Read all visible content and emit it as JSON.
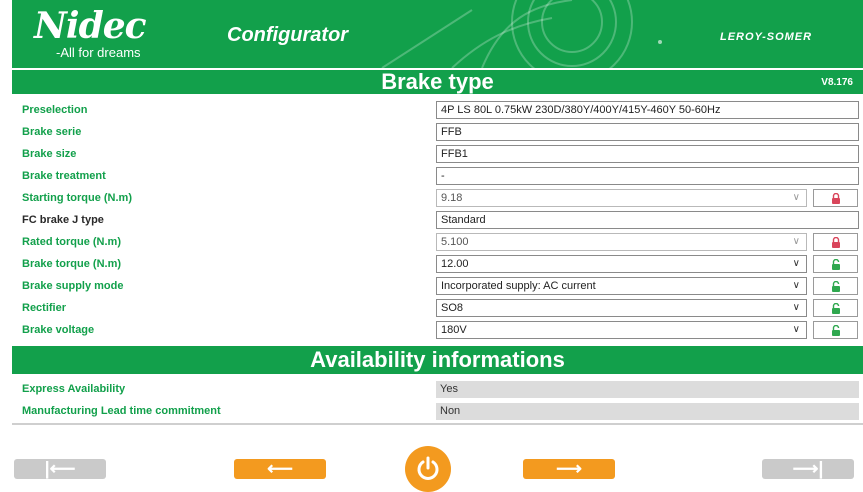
{
  "header": {
    "logo": "Nidec",
    "tagline": "-All for dreams",
    "app_title": "Configurator",
    "brand": "LEROY-SOMER"
  },
  "brake_section": {
    "title": "Brake type",
    "version": "V8.176"
  },
  "fields": [
    {
      "label": "Preselection",
      "value": "4P LS 80L 0.75kW 230D/380Y/400Y/415Y-460Y 50-60Hz",
      "kind": "text"
    },
    {
      "label": "Brake serie",
      "value": "FFB",
      "kind": "text"
    },
    {
      "label": "Brake size",
      "value": "FFB1",
      "kind": "text"
    },
    {
      "label": "Brake treatment",
      "value": "-",
      "kind": "text"
    },
    {
      "label": "Starting torque (N.m)",
      "value": "9.18",
      "kind": "select",
      "enabled": false,
      "lock": "locked"
    },
    {
      "label": "FC brake J type",
      "value": "Standard",
      "kind": "text"
    },
    {
      "label": "Rated torque (N.m)",
      "value": "5.100",
      "kind": "select",
      "enabled": false,
      "lock": "locked"
    },
    {
      "label": "Brake torque (N.m)",
      "value": "12.00",
      "kind": "select",
      "enabled": true,
      "lock": "unlocked"
    },
    {
      "label": "Brake supply mode",
      "value": "Incorporated supply: AC current",
      "kind": "select",
      "enabled": true,
      "lock": "unlocked"
    },
    {
      "label": "Rectifier",
      "value": "SO8",
      "kind": "select",
      "enabled": true,
      "lock": "unlocked"
    },
    {
      "label": "Brake voltage",
      "value": "180V",
      "kind": "select",
      "enabled": true,
      "lock": "unlocked"
    }
  ],
  "availability": {
    "title": "Availability informations",
    "rows": [
      {
        "label": "Express Availability",
        "value": "Yes"
      },
      {
        "label": "Manufacturing Lead time commitment",
        "value": "Non"
      }
    ]
  },
  "nav": {
    "first": "|⟵",
    "prev": "⟵",
    "next": "⟶",
    "last": "⟶|"
  },
  "colors": {
    "brand_green": "#12a04b",
    "nav_orange": "#f39a1f",
    "nav_disabled": "#cacaca",
    "lock_locked": "#d9455b",
    "lock_unlocked": "#2fa84f"
  },
  "icons": {
    "lock_locked": "lock-closed-icon",
    "lock_unlocked": "lock-open-icon",
    "power": "power-icon"
  }
}
